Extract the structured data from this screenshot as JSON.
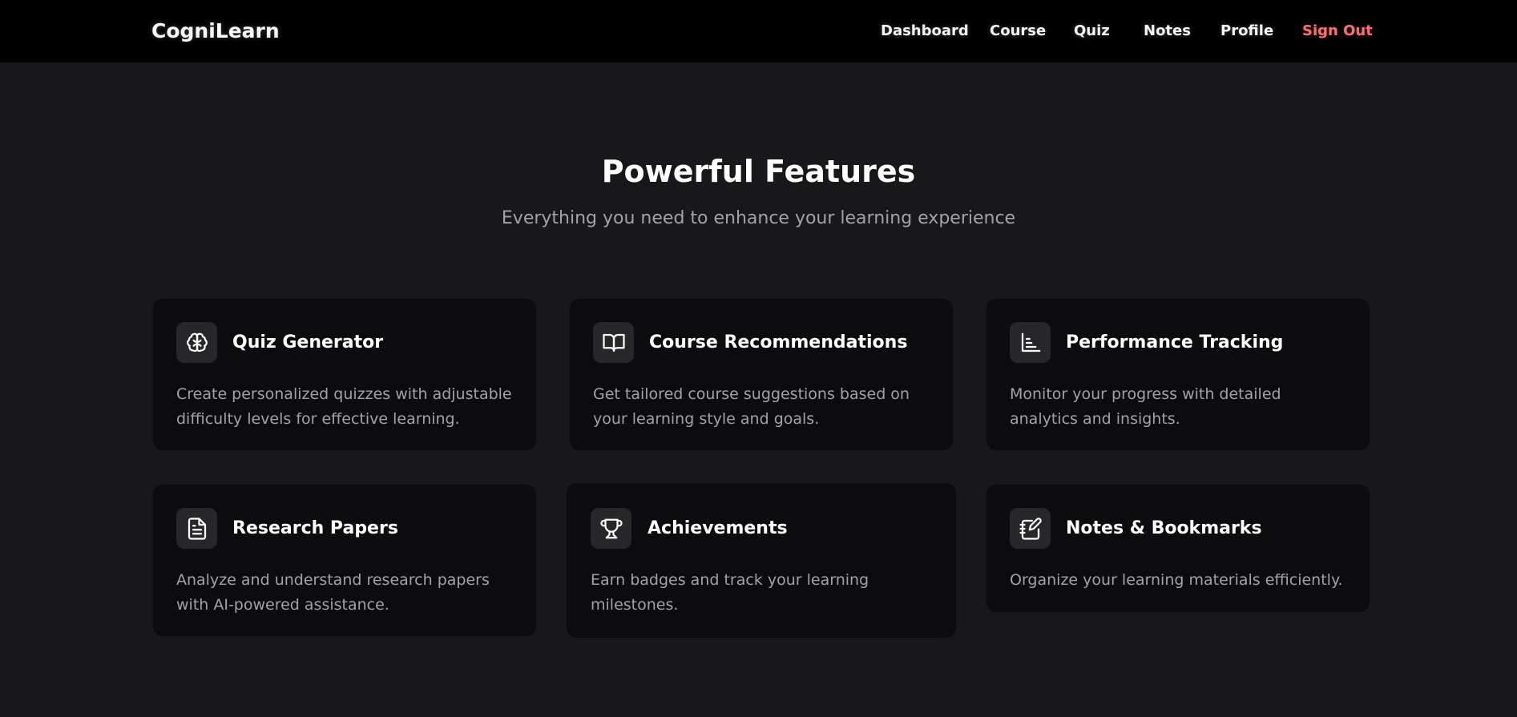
{
  "header": {
    "brand": "CogniLearn",
    "nav": [
      {
        "label": "Dashboard"
      },
      {
        "label": "Course"
      },
      {
        "label": "Quiz"
      },
      {
        "label": "Notes"
      },
      {
        "label": "Profile"
      },
      {
        "label": "Sign Out"
      }
    ]
  },
  "hero": {
    "title": "Powerful Features",
    "subtitle": "Everything you need to enhance your learning experience"
  },
  "features": [
    {
      "icon": "brain-icon",
      "title": "Quiz Generator",
      "description": "Create personalized quizzes with adjustable difficulty levels for effective learning."
    },
    {
      "icon": "book-open-icon",
      "title": "Course Recommendations",
      "description": "Get tailored course suggestions based on your learning style and goals."
    },
    {
      "icon": "bar-chart-icon",
      "title": "Performance Tracking",
      "description": "Monitor your progress with detailed analytics and insights."
    },
    {
      "icon": "file-text-icon",
      "title": "Research Papers",
      "description": "Analyze and understand research papers with AI-powered assistance."
    },
    {
      "icon": "trophy-icon",
      "title": "Achievements",
      "description": "Earn badges and track your learning milestones."
    },
    {
      "icon": "notebook-pen-icon",
      "title": "Notes & Bookmarks",
      "description": "Organize your learning materials efficiently."
    }
  ],
  "colors": {
    "page_background": "#18181b",
    "header_background": "#000000",
    "card_background": "#0c0c0e",
    "icon_box": "#27272a",
    "muted_text": "#a1a1aa",
    "sign_out": "#f87171"
  }
}
